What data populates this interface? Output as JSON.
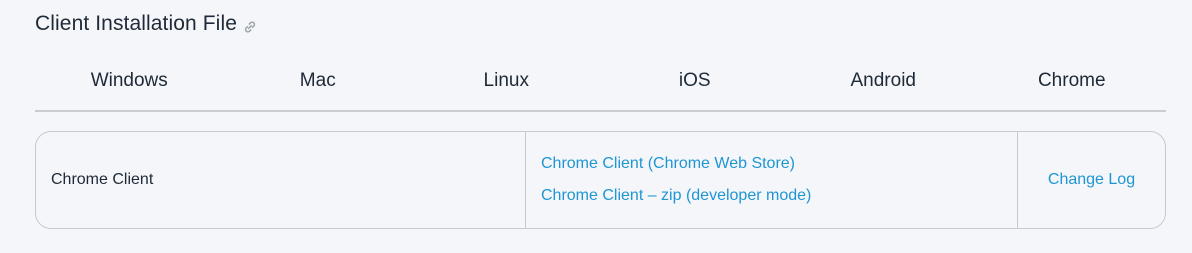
{
  "section": {
    "title": "Client Installation File",
    "anchor_icon": "link-icon"
  },
  "tabs": [
    {
      "label": "Windows"
    },
    {
      "label": "Mac"
    },
    {
      "label": "Linux"
    },
    {
      "label": "iOS"
    },
    {
      "label": "Android"
    },
    {
      "label": "Chrome"
    }
  ],
  "active_tab": "Chrome",
  "row": {
    "name": "Chrome Client",
    "downloads": [
      {
        "label": "Chrome Client (Chrome Web Store)"
      },
      {
        "label": "Chrome Client – zip (developer mode)"
      }
    ],
    "changelog_label": "Change Log"
  },
  "colors": {
    "background": "#f4f6f9",
    "text": "#1f2937",
    "link": "#1f96d3",
    "border": "#c6cad0"
  }
}
